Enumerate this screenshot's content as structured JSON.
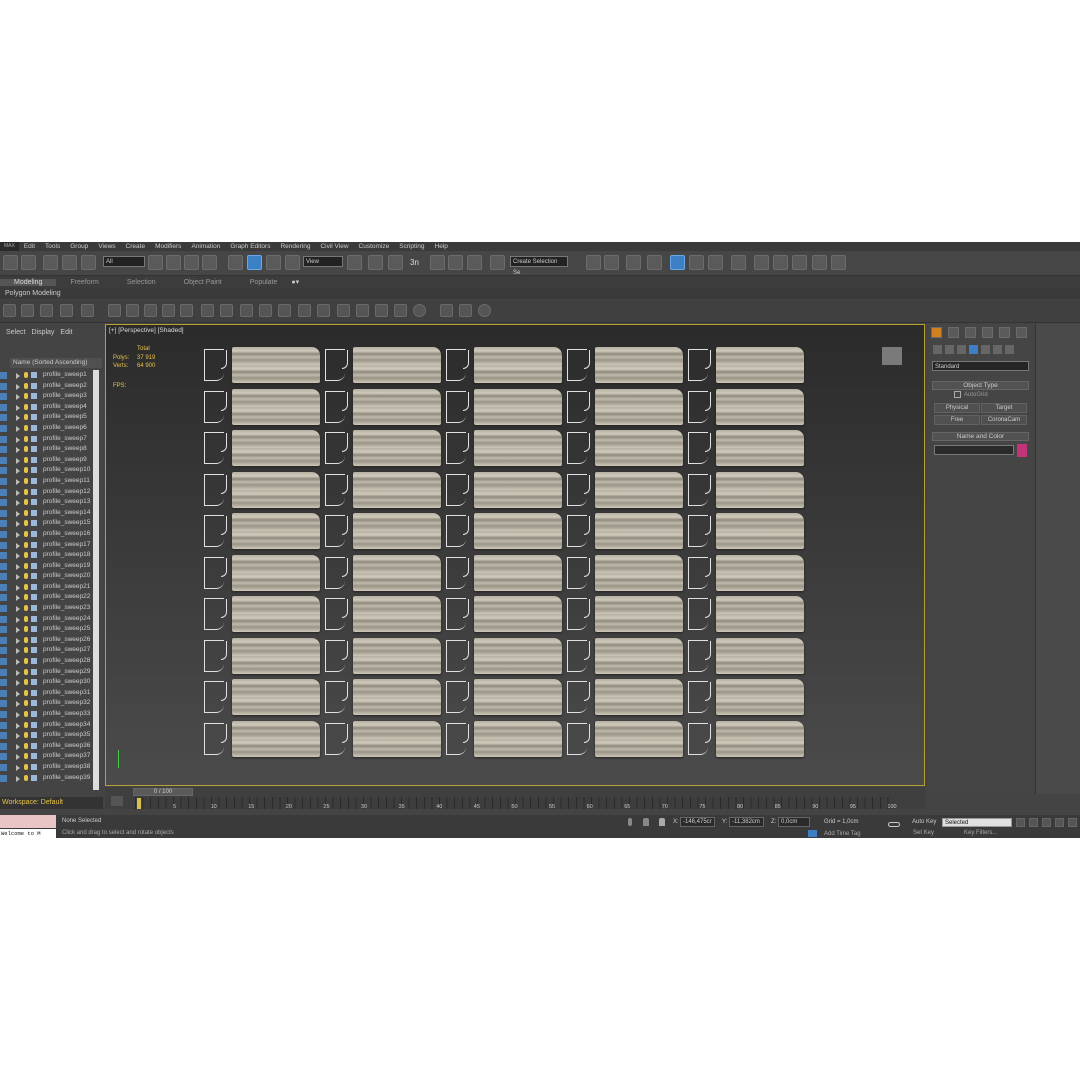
{
  "menu": {
    "logo": "MAX",
    "items": [
      "Edit",
      "Tools",
      "Group",
      "Views",
      "Create",
      "Modifiers",
      "Animation",
      "Graph Editors",
      "Rendering",
      "Civil View",
      "Customize",
      "Scripting",
      "Help"
    ]
  },
  "toolbar": {
    "filter": "All",
    "view": "View",
    "snap_label": "3n",
    "selection_set": "Create Selection Se"
  },
  "ribbon": {
    "tabs": [
      "Modeling",
      "Freeform",
      "Selection",
      "Object Paint",
      "Populate"
    ],
    "active_tab": "Modeling",
    "sub_label": "Polygon Modeling"
  },
  "scene_explorer": {
    "tabs": [
      "Select",
      "Display",
      "Edit"
    ],
    "header": "Name (Sorted Ascending)",
    "items": [
      "profile_sweep1",
      "profile_sweep2",
      "profile_sweep3",
      "profile_sweep4",
      "profile_sweep5",
      "profile_sweep6",
      "profile_sweep7",
      "profile_sweep8",
      "profile_sweep9",
      "profile_sweep10",
      "profile_sweep11",
      "profile_sweep12",
      "profile_sweep13",
      "profile_sweep14",
      "profile_sweep15",
      "profile_sweep16",
      "profile_sweep17",
      "profile_sweep18",
      "profile_sweep19",
      "profile_sweep20",
      "profile_sweep21",
      "profile_sweep22",
      "profile_sweep23",
      "profile_sweep24",
      "profile_sweep25",
      "profile_sweep26",
      "profile_sweep27",
      "profile_sweep28",
      "profile_sweep29",
      "profile_sweep30",
      "profile_sweep31",
      "profile_sweep32",
      "profile_sweep33",
      "profile_sweep34",
      "profile_sweep35",
      "profile_sweep36",
      "profile_sweep37",
      "profile_sweep38",
      "profile_sweep39"
    ],
    "workspace": "Workspace: Default"
  },
  "viewport": {
    "label": "[+] [Perspective] [Shaded]",
    "stats_total": "Total",
    "polys_label": "Polys:",
    "polys_value": "37 919",
    "verts_label": "Verts:",
    "verts_value": "64 900",
    "fps_label": "FPS:",
    "rows": 10,
    "columns": 5
  },
  "command_panel": {
    "dropdown": "Standard",
    "object_type": "Object Type",
    "autogrid": "AutoGrid",
    "buttons": [
      "Physical",
      "Target",
      "Free",
      "CoronaCam"
    ],
    "name_and_color": "Name and Color",
    "color": "#c2337a"
  },
  "timeline": {
    "frame": "0 / 100",
    "ticks": [
      "5",
      "10",
      "15",
      "20",
      "25",
      "30",
      "35",
      "40",
      "45",
      "50",
      "55",
      "60",
      "65",
      "70",
      "75",
      "80",
      "85",
      "90",
      "95",
      "100"
    ]
  },
  "status": {
    "maxscript": "Welcome to M",
    "selected": "None Selected",
    "hint": "Click and drag to select and rotate objects",
    "x_label": "X:",
    "x_value": "-146,475cr",
    "y_label": "Y:",
    "y_value": "-11,382cm",
    "z_label": "Z:",
    "z_value": "0,0cm",
    "grid": "Grid = 1,0cm",
    "add_time_tag": "Add Time Tag",
    "auto_key": "Auto Key",
    "set_key": "Set Key",
    "selected_dropdown": "Selected",
    "key_filters": "Key Filters..."
  }
}
